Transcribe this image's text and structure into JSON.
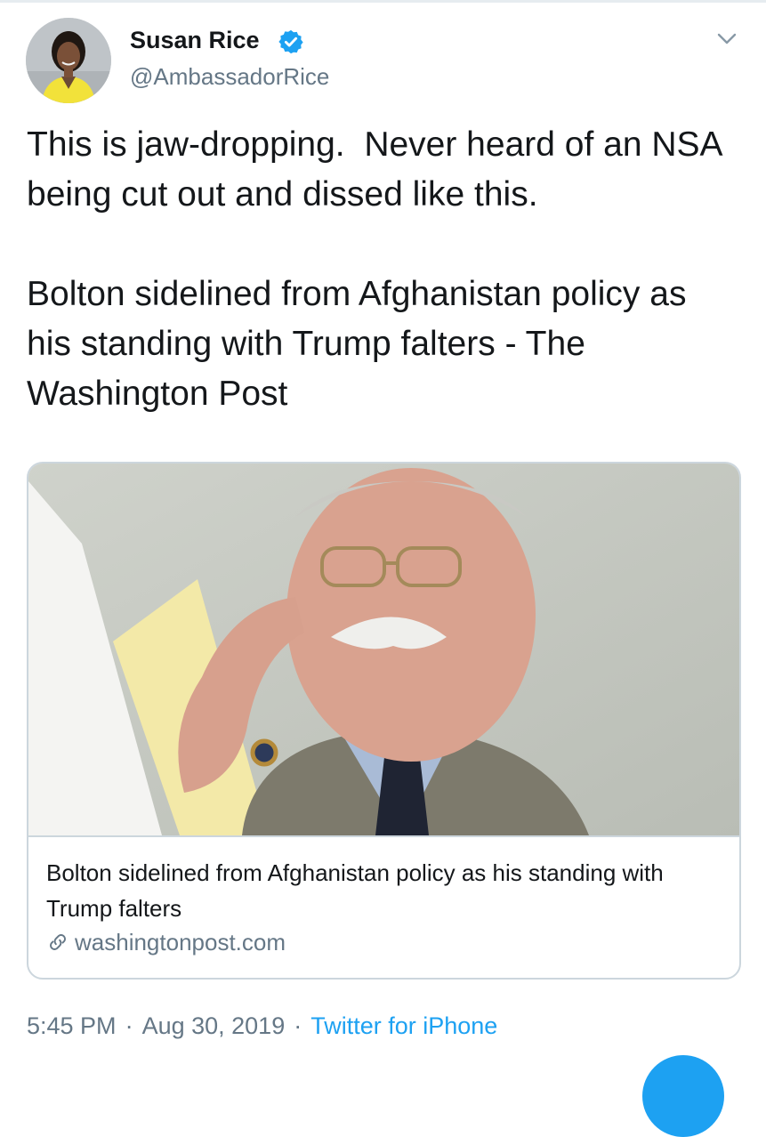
{
  "tweet": {
    "display_name": "Susan Rice",
    "handle": "@AmbassadorRice",
    "verified": true,
    "text_paragraphs": [
      "This is jaw-dropping.  Never heard of an NSA being cut out and dissed like this.",
      "Bolton sidelined from Afghanistan policy as his standing with Trump falters - The Washington Post"
    ]
  },
  "card": {
    "title": "Bolton sidelined from Afghanistan policy as his standing with Trump falters",
    "domain": "washingtonpost.com"
  },
  "meta": {
    "time": "5:45 PM",
    "separator": "·",
    "date": "Aug 30, 2019",
    "source": "Twitter for iPhone"
  },
  "icons": {
    "verified": "verified-badge-icon",
    "caret": "chevron-down-icon",
    "link": "link-icon"
  },
  "colors": {
    "accent": "#1da1f2",
    "secondary_text": "#657786",
    "border": "#ccd6dd"
  }
}
